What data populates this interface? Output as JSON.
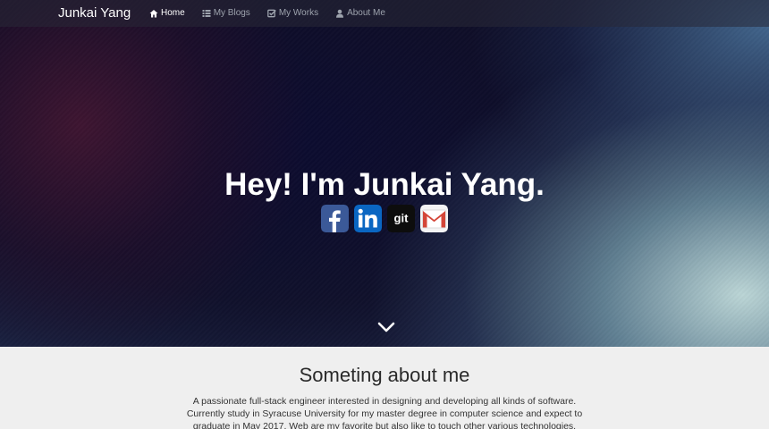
{
  "window": {
    "title": "Junkai Yang"
  },
  "navbar": {
    "brand": "Junkai Yang",
    "items": [
      {
        "label": "Home",
        "icon": "home-icon",
        "active": true
      },
      {
        "label": "My Blogs",
        "icon": "list-icon",
        "active": false
      },
      {
        "label": "My Works",
        "icon": "checkbox-icon",
        "active": false
      },
      {
        "label": "About Me",
        "icon": "user-icon",
        "active": false
      }
    ]
  },
  "hero": {
    "title": "Hey! I'm Junkai Yang.",
    "social": [
      {
        "name": "facebook",
        "icon": "facebook-icon",
        "glyph": "f",
        "color": "#3b5998"
      },
      {
        "name": "linkedin",
        "icon": "linkedin-icon",
        "glyph": "in",
        "color": "#0a66c2"
      },
      {
        "name": "github",
        "icon": "git-icon",
        "glyph": "git",
        "color": "#111111"
      },
      {
        "name": "gmail",
        "icon": "gmail-icon",
        "glyph": "M",
        "color": "#d44638"
      }
    ],
    "scroll_icon": "chevron-down-icon"
  },
  "about": {
    "title": "Someting about me",
    "lines": [
      "A passionate full-stack engineer interested in designing and developing all kinds of software.",
      "Currently study in Syracuse University for my master degree in computer science and expect to",
      "graduate in May 2017. Web are my favorite but also like to touch other various technologies."
    ]
  },
  "colors": {
    "nav_active": "#ffffff",
    "nav_inactive": "#9da3ad",
    "about_bg": "#efefef"
  }
}
